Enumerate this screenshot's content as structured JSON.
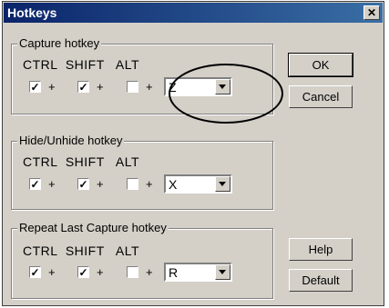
{
  "window": {
    "title": "Hotkeys",
    "close_glyph": "✕"
  },
  "groups": [
    {
      "legend": "Capture hotkey",
      "mod_labels": "CTRL  SHIFT   ALT",
      "ctrl": "✓",
      "shift": "✓",
      "alt": "",
      "key": "Z"
    },
    {
      "legend": "Hide/Unhide hotkey",
      "mod_labels": "CTRL  SHIFT   ALT",
      "ctrl": "✓",
      "shift": "✓",
      "alt": "",
      "key": "X"
    },
    {
      "legend": "Repeat Last Capture hotkey",
      "mod_labels": "CTRL  SHIFT   ALT",
      "ctrl": "✓",
      "shift": "✓",
      "alt": "",
      "key": "R"
    }
  ],
  "plus": "+",
  "buttons": {
    "ok": "OK",
    "cancel": "Cancel",
    "help": "Help",
    "default": "Default"
  }
}
